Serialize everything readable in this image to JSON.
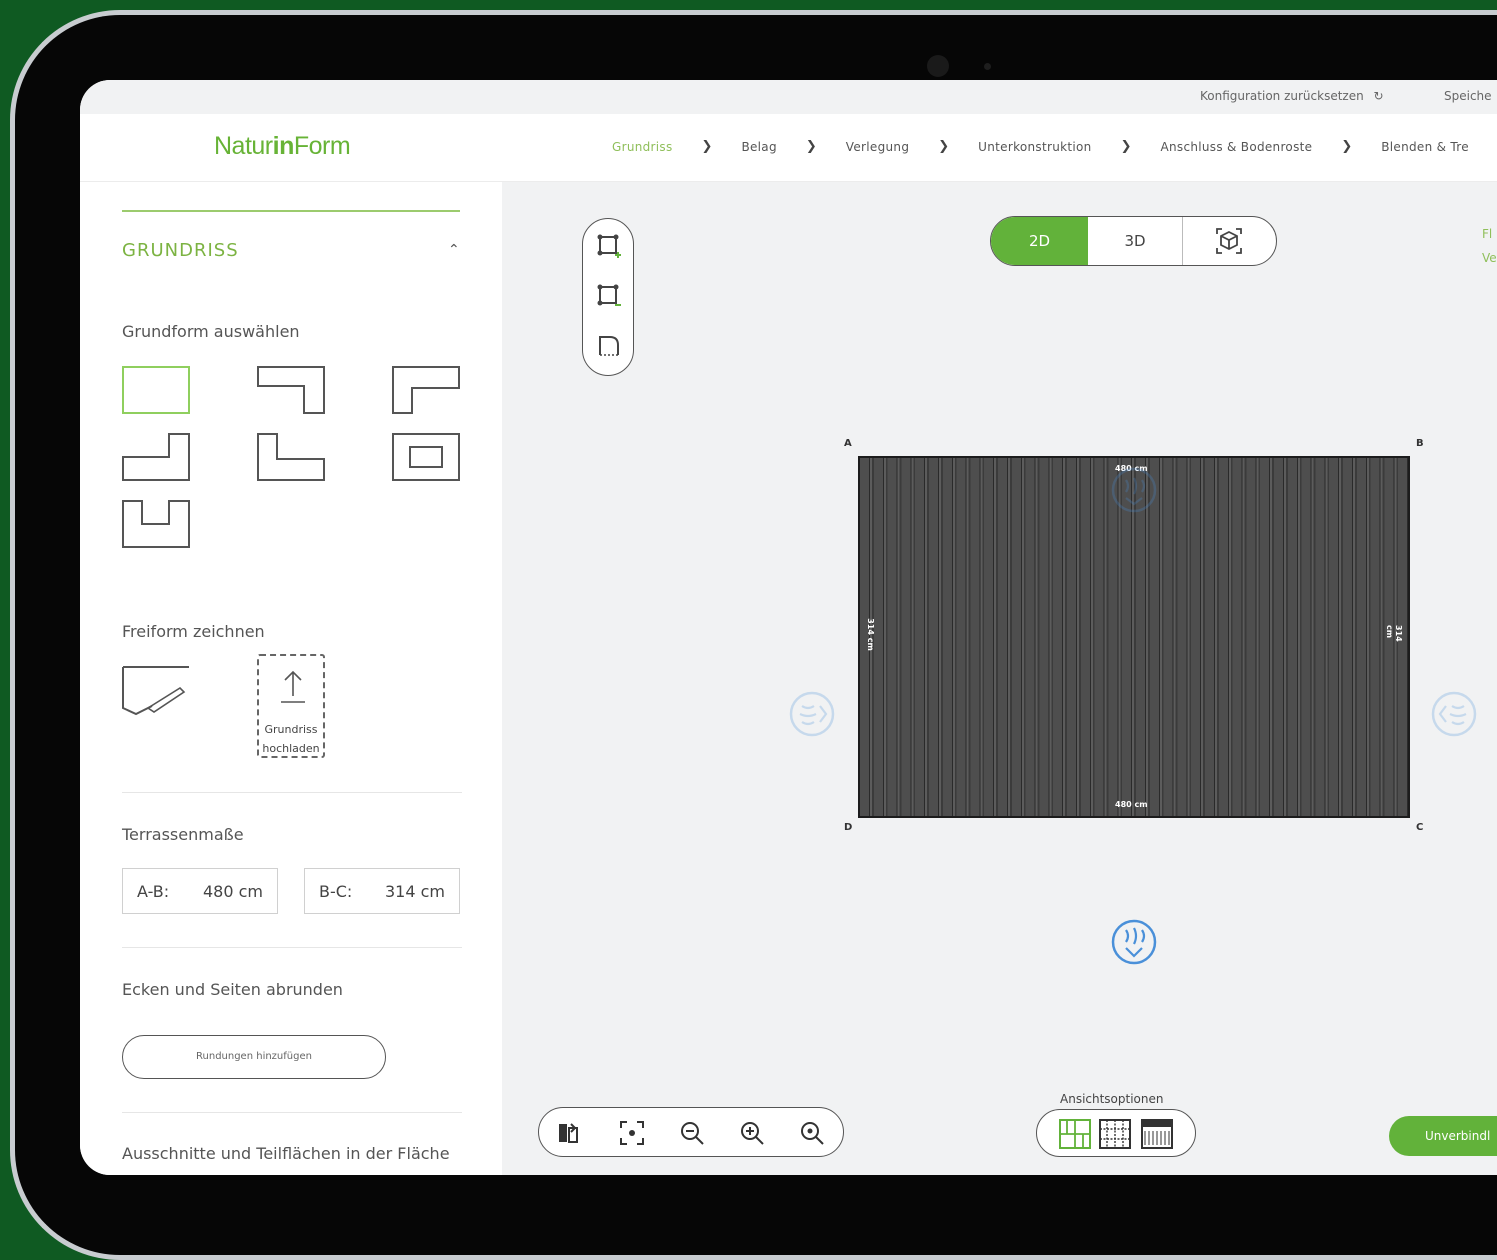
{
  "top": {
    "reset_label": "Konfiguration zurücksetzen",
    "save_label": "Speiche"
  },
  "brand": {
    "part1": "Natur",
    "part2": "in",
    "part3": "Form"
  },
  "steps": [
    "Grundriss",
    "Belag",
    "Verlegung",
    "Unterkonstruktion",
    "Anschluss & Bodenroste",
    "Blenden & Tre"
  ],
  "sidebar": {
    "section_title": "GRUNDRISS",
    "shape_label": "Grundform auswählen",
    "freeform_label": "Freiform zeichnen",
    "upload_line1": "Grundriss",
    "upload_line2": "hochladen",
    "dims_label": "Terrassenmaße",
    "dim_ab_key": "A-B:",
    "dim_ab_value": "480 cm",
    "dim_bc_key": "B-C:",
    "dim_bc_value": "314 cm",
    "round_label": "Ecken und Seiten abrunden",
    "round_button": "Rundungen hinzufügen",
    "cutout_label": "Ausschnitte und Teilflächen in der Fläche"
  },
  "canvas": {
    "view_2d": "2D",
    "view_3d": "3D",
    "corners": {
      "a": "A",
      "b": "B",
      "c": "C",
      "d": "D"
    },
    "dim_top": "480 cm",
    "dim_bottom": "480 cm",
    "dim_left": "314 cm",
    "dim_right": "314 cm",
    "view_options_title": "Ansichtsoptionen",
    "quote_button": "Unverbindl",
    "right_line1": "Fl",
    "right_line2": "Ve"
  },
  "colors": {
    "accent": "#62b23a",
    "accent_text": "#7cb342",
    "water_icon": "#4a90d9"
  }
}
